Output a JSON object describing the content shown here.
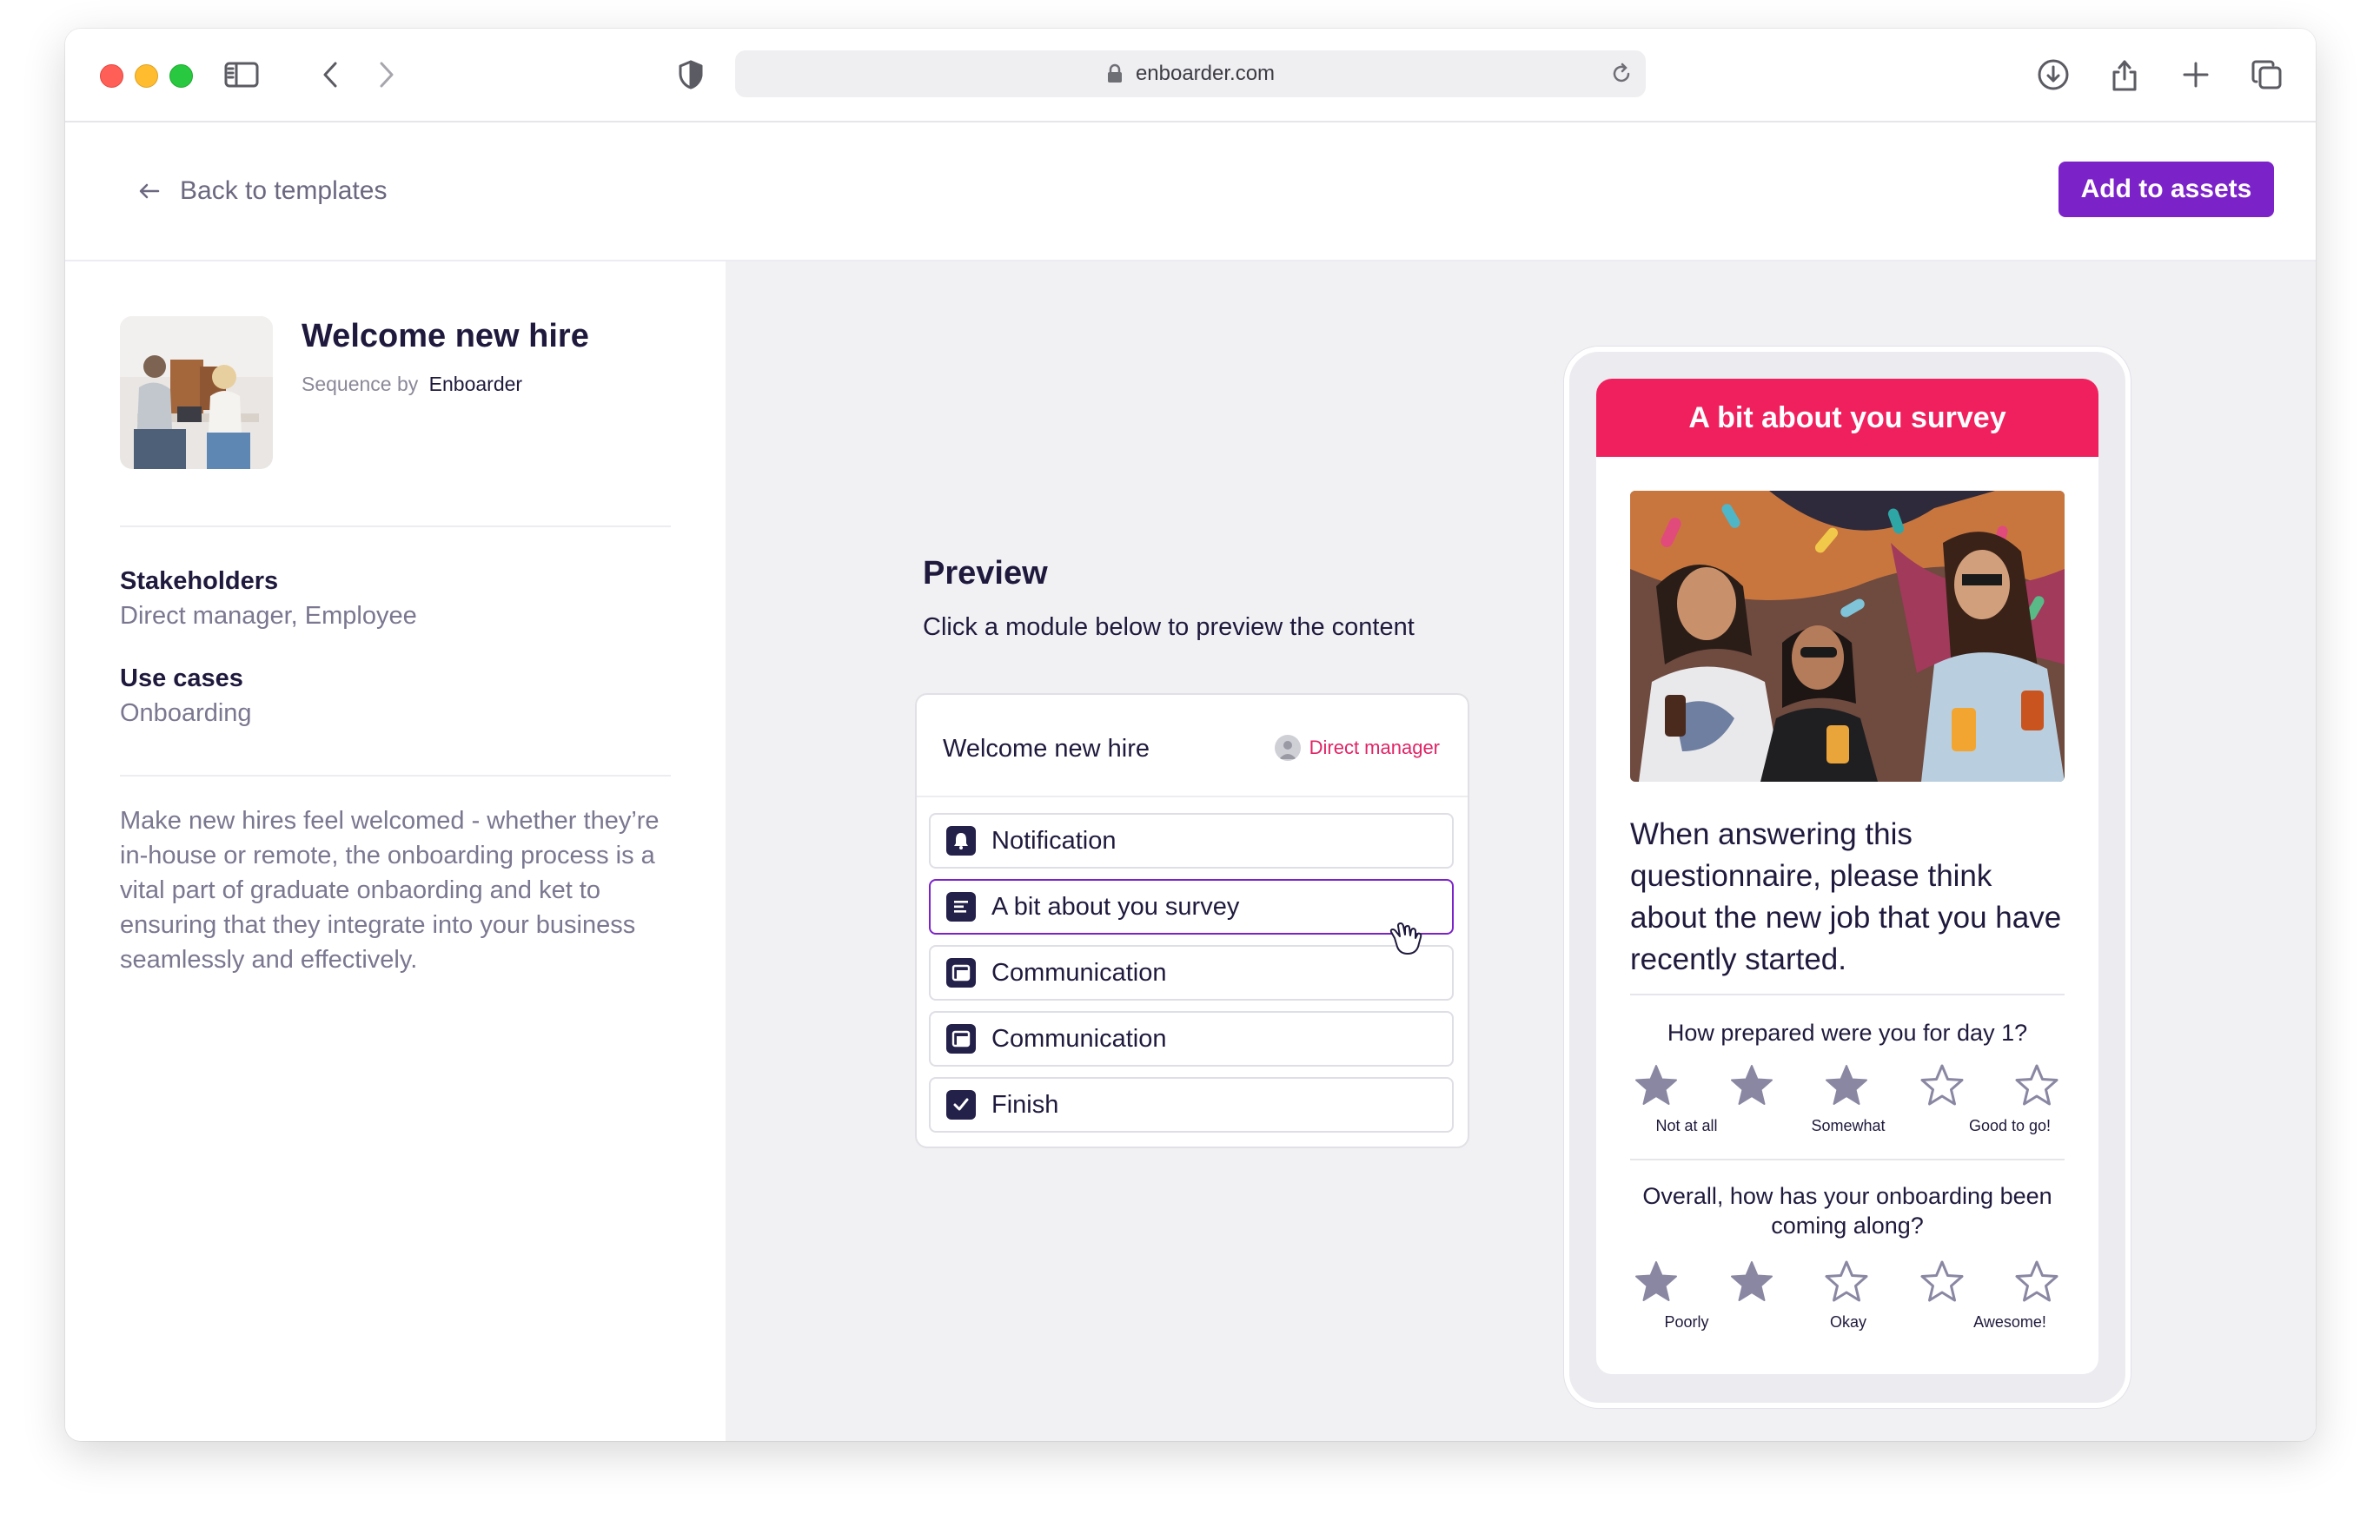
{
  "browser": {
    "url": "enboarder.com"
  },
  "header": {
    "back_label": "Back to templates",
    "add_button": "Add to assets"
  },
  "template": {
    "title": "Welcome new hire",
    "sequence_by_label": "Sequence by",
    "author": "Enboarder",
    "stakeholders_label": "Stakeholders",
    "stakeholders_value": "Direct manager, Employee",
    "use_cases_label": "Use cases",
    "use_cases_value": "Onboarding",
    "description": "Make new hires feel welcomed - whether they’re in-house or remote, the onboarding process is a vital part of graduate onbaording and ket to ensuring that they integrate into your business seamlessly and effectively."
  },
  "preview": {
    "title": "Preview",
    "subtitle": "Click a module below to preview the content",
    "card_title": "Welcome new hire",
    "role_label": "Direct manager",
    "modules": [
      {
        "label": "Notification",
        "icon": "bell-icon",
        "active": false
      },
      {
        "label": "A bit about you survey",
        "icon": "survey-icon",
        "active": true
      },
      {
        "label": "Communication",
        "icon": "communication-icon",
        "active": false
      },
      {
        "label": "Communication",
        "icon": "communication-icon",
        "active": false
      },
      {
        "label": "Finish",
        "icon": "checkbox-icon",
        "active": false
      }
    ]
  },
  "survey": {
    "header": "A bit about you survey",
    "intro": "When answering this questionnaire, please think about the new job that you have recently started.",
    "questions": [
      {
        "text": "How prepared were you for day 1?",
        "rating": 3,
        "max": 5,
        "labels": [
          "Not at all",
          "Somewhat",
          "Good to go!"
        ]
      },
      {
        "text": "Overall, how has your onboarding been coming along?",
        "rating": 2,
        "max": 5,
        "labels": [
          "Poorly",
          "Okay",
          "Awesome!"
        ]
      }
    ]
  },
  "colors": {
    "accent_purple": "#7c22c9",
    "survey_pink": "#f0205e",
    "navy": "#1f1a3d",
    "star_filled": "#8a87a3"
  }
}
